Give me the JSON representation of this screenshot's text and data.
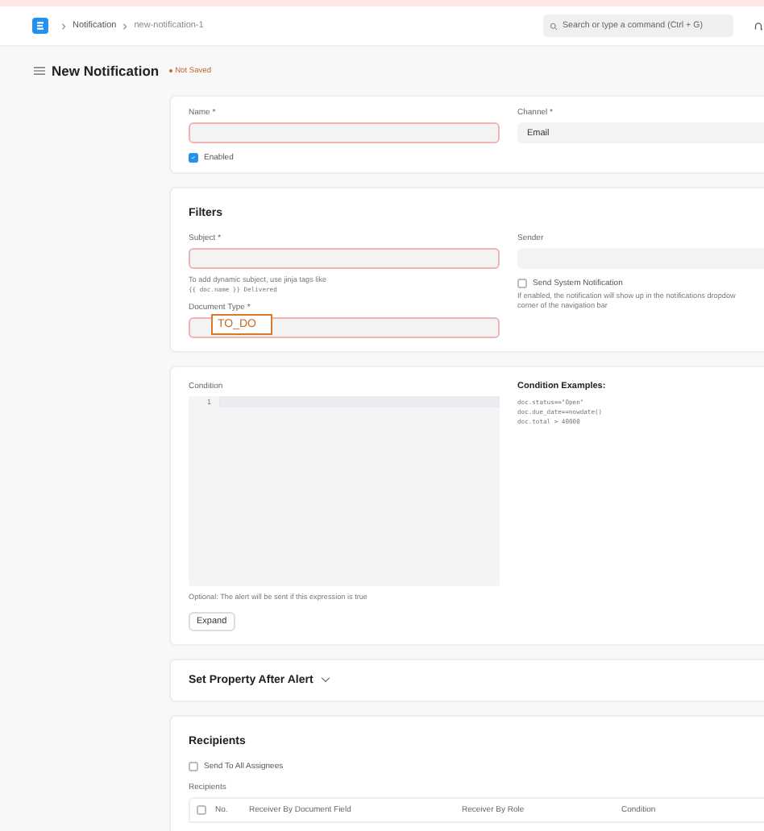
{
  "navbar": {
    "breadcrumbs": [
      "Notification",
      "new-notification-1"
    ],
    "search": {
      "placeholder": "Search or type a command (Ctrl + G)"
    }
  },
  "page": {
    "title": "New Notification",
    "status": "Not Saved"
  },
  "main": {
    "name": {
      "label": "Name *",
      "required": true
    },
    "channel": {
      "label": "Channel *",
      "value": "Email"
    },
    "enabled": {
      "label": "Enabled",
      "checked": true
    }
  },
  "filters": {
    "title": "Filters",
    "subject": {
      "label": "Subject *",
      "required": true,
      "hint": "To add dynamic subject, use jinja tags like",
      "code": "{{ doc.name }} Delivered"
    },
    "document_type": {
      "label": "Document Type *",
      "required": true,
      "annotation": "TO_DO"
    },
    "sender": {
      "label": "Sender"
    },
    "system_notification": {
      "label": "Send System Notification",
      "checked": false,
      "hint_lines": [
        "If enabled, the notification will show up in the notifications dropdow",
        "corner of the navigation bar"
      ]
    }
  },
  "condition": {
    "label": "Condition",
    "line_number": "1",
    "hint": "Optional: The alert will be sent if this expression is true",
    "button": "Expand",
    "examples_title": "Condition Examples:",
    "examples": [
      "doc.status==\"Open\"",
      "doc.due_date==nowdate()",
      "doc.total > 40000"
    ]
  },
  "set_property": {
    "title": "Set Property After Alert",
    "expanded": false
  },
  "recipients": {
    "title": "Recipients",
    "send_to_all": {
      "label": "Send To All Assignees",
      "checked": false
    },
    "table_label": "Recipients",
    "header_checkbox": {
      "checked": false
    },
    "columns": [
      "No.",
      "Receiver By Document Field",
      "Receiver By Role",
      "Condition"
    ]
  }
}
